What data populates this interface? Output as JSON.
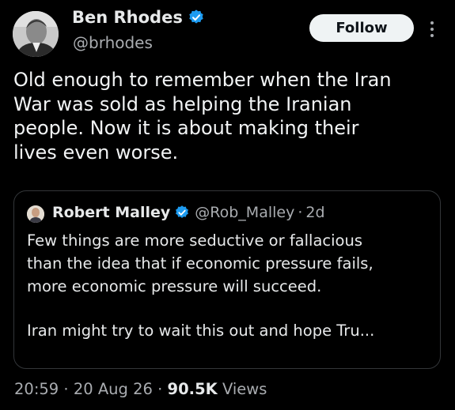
{
  "author": {
    "name": "Ben Rhodes",
    "handle": "@brhodes",
    "verified": true
  },
  "follow_button": {
    "label": "Follow"
  },
  "more_icon": "more-vertical-icon",
  "tweet": {
    "lines": [
      "Old enough to remember when the Iran",
      "War was sold as helping the Iranian",
      "people. Now it is about making their",
      "lives even worse."
    ]
  },
  "quoted_tweet": {
    "name": "Robert Malley",
    "handle": "@Rob_Malley",
    "separator": "·",
    "age": "2d",
    "verified": true,
    "paragraph1": [
      "Few things are more seductive or fallacious",
      "than the idea that if economic pressure fails,",
      "more economic pressure will succeed."
    ],
    "paragraph2": [
      "Iran might try to wait this out and hope Tru..."
    ]
  },
  "footer": {
    "time": "20:59",
    "sep1": "·",
    "date": "20 Aug 26",
    "sep2": "·",
    "views_count": "90.5K",
    "views_label": "Views"
  },
  "colors": {
    "background": "#000000",
    "text_primary": "#e7e9ea",
    "text_secondary": "#a9acb0",
    "verified_blue": "#1d9bf0",
    "follow_bg": "#eff3f4",
    "border": "#333639"
  }
}
